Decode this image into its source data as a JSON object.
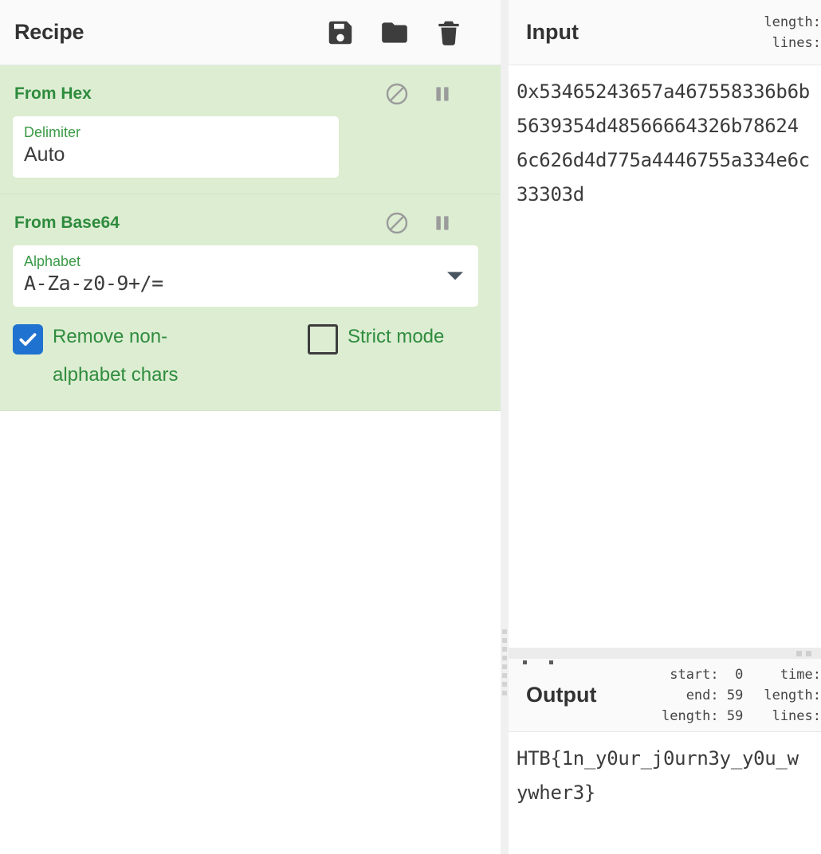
{
  "recipe": {
    "title": "Recipe",
    "controls": [
      {
        "name": "save-icon",
        "label": "Save recipe"
      },
      {
        "name": "folder-icon",
        "label": "Load recipe"
      },
      {
        "name": "trash-icon",
        "label": "Clear recipe"
      }
    ],
    "operations": [
      {
        "title": "From Hex",
        "disable_icon": "ban-icon",
        "breakpoint_icon": "pause-icon",
        "args": [
          {
            "type": "text",
            "label": "Delimiter",
            "value": "Auto"
          }
        ]
      },
      {
        "title": "From Base64",
        "disable_icon": "ban-icon",
        "breakpoint_icon": "pause-icon",
        "args": [
          {
            "type": "select",
            "label": "Alphabet",
            "value": "A-Za-z0-9+/="
          },
          {
            "type": "checkbox",
            "label": "Remove non-alphabet chars",
            "checked": true
          },
          {
            "type": "checkbox",
            "label": "Strict mode",
            "checked": false
          }
        ]
      }
    ]
  },
  "input": {
    "title": "Input",
    "meta": {
      "length_label": "length:",
      "lines_label": "lines:"
    },
    "value": "0x53465243657a467558336b6b\n5639354d48566664326b78624\n6c626d4d775a4446755a334e6c\n33303d"
  },
  "output": {
    "title": "Output",
    "meta_left": [
      "start:  0",
      "  end: 59",
      "length: 59"
    ],
    "meta_right": [
      "  time:",
      "length:",
      " lines:"
    ],
    "value": "HTB{1n_y0ur_j0urn3y_y0u_w\nywher3}"
  },
  "colors": {
    "operation_bg": "#dcedd2",
    "operation_title": "#2e8b3d",
    "arg_label": "#3a9a46",
    "checkbox_checked": "#1f72d0",
    "panel_header_bg": "#fafafa",
    "splitter": "#ececec"
  }
}
